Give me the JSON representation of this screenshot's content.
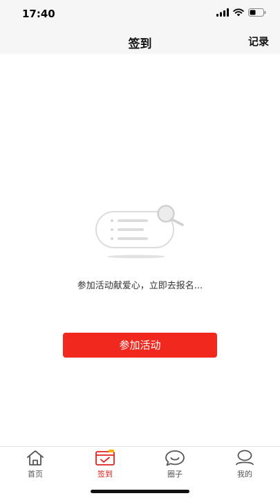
{
  "status_bar": {
    "time": "17:40"
  },
  "nav": {
    "title": "签到",
    "action": "记录"
  },
  "empty_state": {
    "message": "参加活动献爱心，立即去报名..."
  },
  "join_button": {
    "label": "参加活动"
  },
  "tabs": [
    {
      "label": "首页",
      "icon": "home-icon",
      "active": false
    },
    {
      "label": "签到",
      "icon": "sign-in-icon",
      "active": true
    },
    {
      "label": "圈子",
      "icon": "chat-bubble-icon",
      "active": false
    },
    {
      "label": "我的",
      "icon": "user-icon",
      "active": false
    }
  ],
  "colors": {
    "accent": "#f0281e",
    "active_tab": "#e0201a"
  }
}
